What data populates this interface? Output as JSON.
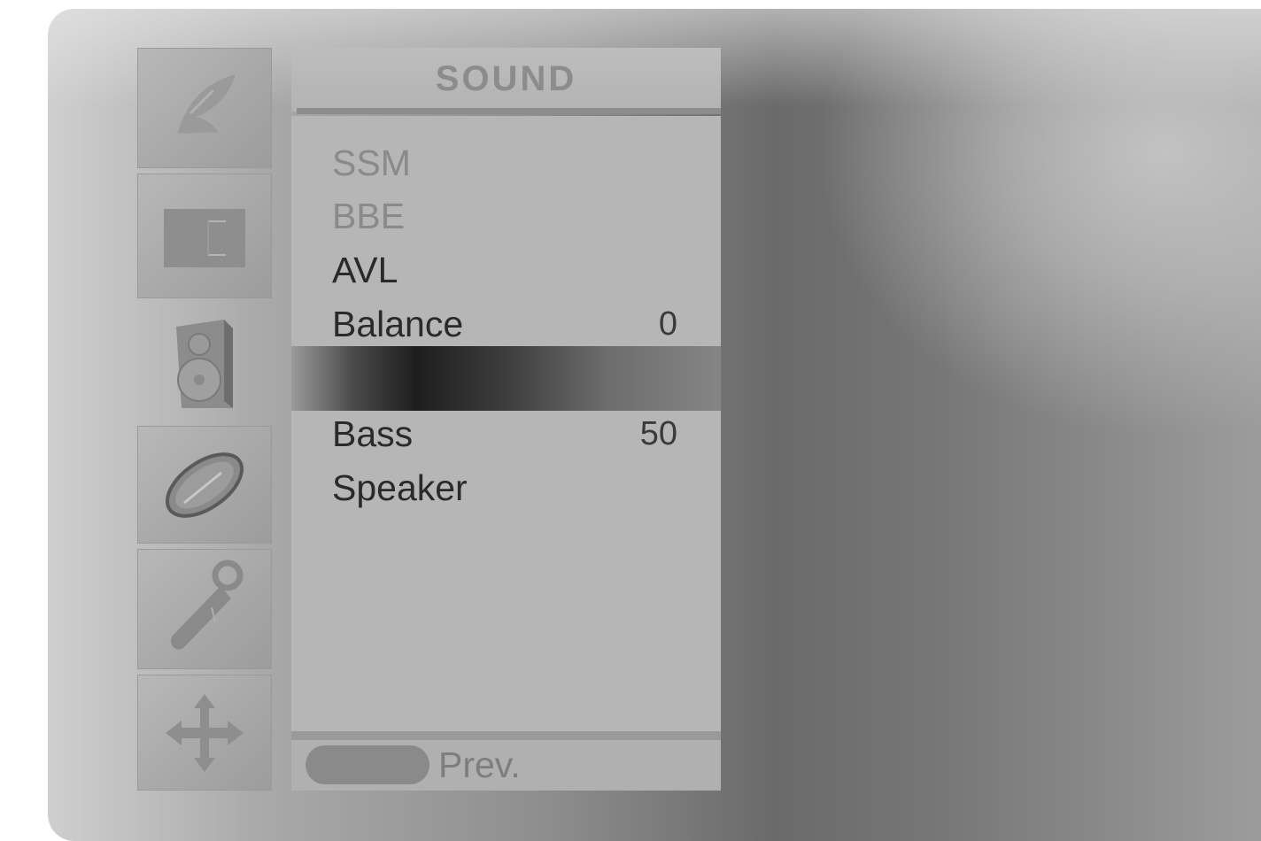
{
  "menu": {
    "title": "SOUND",
    "items": [
      {
        "label": "SSM",
        "value": "",
        "enabled": false
      },
      {
        "label": "BBE",
        "value": "",
        "enabled": false
      },
      {
        "label": "AVL",
        "value": "",
        "enabled": true
      },
      {
        "label": "Balance",
        "value": "0",
        "enabled": true
      },
      {
        "label": "",
        "value": "",
        "enabled": true,
        "selected": true
      },
      {
        "label": "Bass",
        "value": "50",
        "enabled": true
      },
      {
        "label": "Speaker",
        "value": "",
        "enabled": true
      }
    ]
  },
  "footer": {
    "prev_label": "Prev."
  },
  "sidebar": {
    "icons": [
      {
        "name": "station-icon"
      },
      {
        "name": "picture-icon"
      },
      {
        "name": "sound-icon",
        "active": true
      },
      {
        "name": "time-icon"
      },
      {
        "name": "option-icon"
      },
      {
        "name": "screen-icon"
      }
    ]
  },
  "colors": {
    "panel": "#b6b6b6",
    "text": "#2a2a2a",
    "dim_text": "#8a8a8a",
    "selected_bar": "#1e1e1e"
  }
}
